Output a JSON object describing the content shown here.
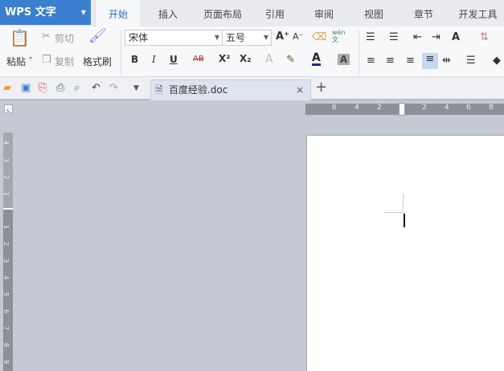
{
  "app": {
    "logo_label": "WPS 文字"
  },
  "menu_tabs": [
    {
      "label": "开始",
      "active": true
    },
    {
      "label": "插入"
    },
    {
      "label": "页面布局"
    },
    {
      "label": "引用"
    },
    {
      "label": "审阅"
    },
    {
      "label": "视图"
    },
    {
      "label": "章节"
    },
    {
      "label": "开发工具"
    }
  ],
  "ribbon": {
    "paste": "粘贴",
    "cut": "剪切",
    "copy": "复制",
    "format_painter": "格式刷",
    "font_name": "宋体",
    "font_size": "五号",
    "bold": "B",
    "italic": "I",
    "underline": "U",
    "strike": "AB",
    "superscript": "X²",
    "subscript": "X₂",
    "grow": "A⁺",
    "shrink": "A⁻",
    "pinyin": "wén文",
    "font_color": "A",
    "char_shade": "A",
    "text_effect": "A"
  },
  "document_tab": {
    "name": "百度经验.doc",
    "close": "×",
    "new": "+"
  },
  "hruler": {
    "labels": [
      "6",
      "4",
      "2",
      "2",
      "4",
      "6",
      "8"
    ]
  },
  "vruler": {
    "labels": [
      "4",
      "3",
      "2",
      "1",
      "1",
      "2",
      "3",
      "4",
      "5",
      "6",
      "7",
      "8",
      "9"
    ]
  },
  "accent": "#3a7fd0"
}
